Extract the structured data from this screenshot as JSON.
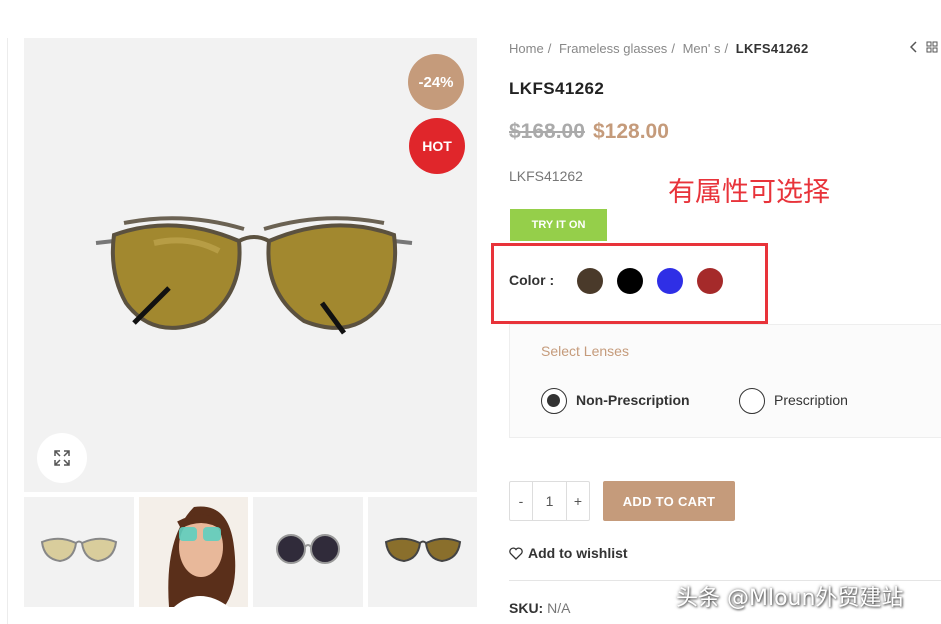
{
  "breadcrumb": [
    "Home",
    "Frameless glasses",
    "Men' s"
  ],
  "breadcrumb_current": "LKFS41262",
  "badges": {
    "discount": "-24%",
    "hot": "HOT"
  },
  "product": {
    "title": "LKFS41262",
    "price_old": "$168.00",
    "price_new": "$128.00",
    "sku_line": "LKFS41262",
    "try_on": "TRY IT ON",
    "color_label": "Color :",
    "colors": [
      "#4a3a2a",
      "#000000",
      "#2f2fe6",
      "#a52a2a"
    ]
  },
  "annotation": "有属性可选择",
  "lenses": {
    "title": "Select Lenses",
    "options": [
      {
        "label": "Non-Prescription",
        "selected": true
      },
      {
        "label": "Prescription",
        "selected": false
      }
    ]
  },
  "cart": {
    "minus": "-",
    "qty": "1",
    "plus": "+",
    "button": "ADD TO CART"
  },
  "wishlist": "Add to wishlist",
  "sku": {
    "key": "SKU:",
    "value": "N/A"
  },
  "watermark": "头条 @Mloun外贸建站"
}
